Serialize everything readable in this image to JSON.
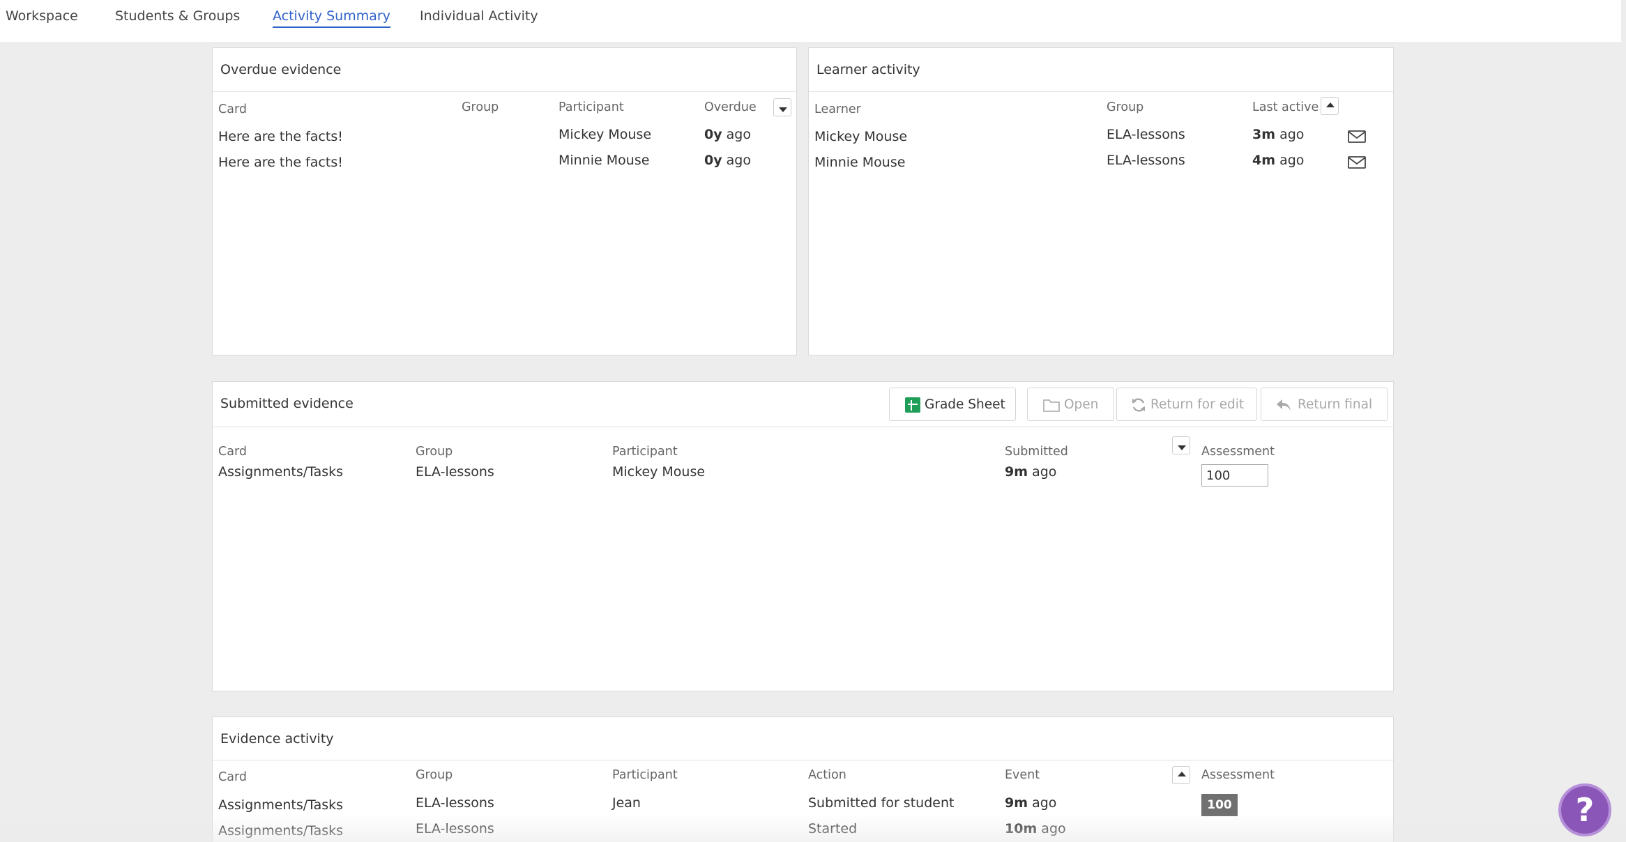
{
  "nav": {
    "tabs": [
      {
        "label": "Workspace"
      },
      {
        "label": "Students & Groups"
      },
      {
        "label": "Activity Summary"
      },
      {
        "label": "Individual Activity"
      }
    ]
  },
  "overdue": {
    "title": "Overdue evidence",
    "headers": {
      "card": "Card",
      "group": "Group",
      "participant": "Participant",
      "overdue": "Overdue"
    },
    "rows": [
      {
        "card": "Here are the facts!",
        "group": "",
        "participant": "Mickey Mouse",
        "overdue_value": "0y",
        "overdue_suffix": "ago"
      },
      {
        "card": "Here are the facts!",
        "group": "",
        "participant": "Minnie Mouse",
        "overdue_value": "0y",
        "overdue_suffix": "ago"
      }
    ]
  },
  "learner": {
    "title": "Learner activity",
    "headers": {
      "learner": "Learner",
      "group": "Group",
      "last_active": "Last active"
    },
    "rows": [
      {
        "learner": "Mickey Mouse",
        "group": "ELA-lessons",
        "last_value": "3m",
        "last_suffix": "ago"
      },
      {
        "learner": "Minnie Mouse",
        "group": "ELA-lessons",
        "last_value": "4m",
        "last_suffix": "ago"
      }
    ]
  },
  "submitted": {
    "title": "Submitted evidence",
    "toolbar": {
      "grade_sheet": "Grade Sheet",
      "open": "Open",
      "return_edit": "Return for edit",
      "return_final": "Return final"
    },
    "headers": {
      "card": "Card",
      "group": "Group",
      "participant": "Participant",
      "submitted": "Submitted",
      "assessment": "Assessment"
    },
    "rows": [
      {
        "card": "Assignments/Tasks",
        "group": "ELA-lessons",
        "participant": "Mickey Mouse",
        "sub_value": "9m",
        "sub_suffix": "ago",
        "assessment": "100"
      }
    ]
  },
  "evidence": {
    "title": "Evidence activity",
    "headers": {
      "card": "Card",
      "group": "Group",
      "participant": "Participant",
      "action": "Action",
      "event": "Event",
      "assessment": "Assessment"
    },
    "rows": [
      {
        "card": "Assignments/Tasks",
        "group": "ELA-lessons",
        "participant": "Jean",
        "action": "Submitted for student",
        "event_value": "9m",
        "event_suffix": "ago",
        "assessment": "100"
      },
      {
        "card": "Assignments/Tasks",
        "group": "ELA-lessons",
        "participant": "",
        "action": "Started",
        "event_value": "10m",
        "event_suffix": "ago",
        "assessment": ""
      }
    ]
  },
  "help": {
    "symbol": "?"
  },
  "colors": {
    "accent": "#2f62c8",
    "help_purple": "#8a56b8",
    "sheets_green": "#1e9e56",
    "badge_gray": "#707070"
  }
}
